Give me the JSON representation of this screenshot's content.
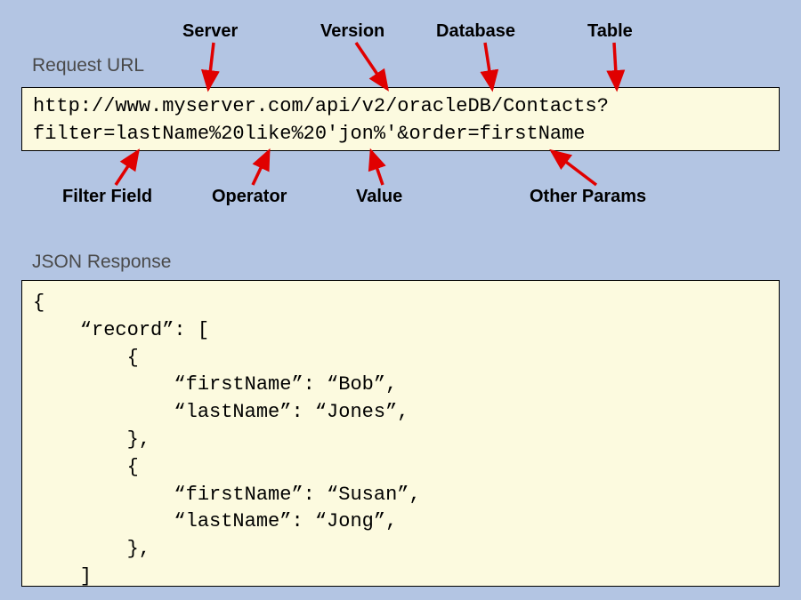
{
  "labels": {
    "request_url": "Request URL",
    "json_response": "JSON Response"
  },
  "annotations": {
    "server": "Server",
    "version": "Version",
    "database": "Database",
    "table": "Table",
    "filter_field": "Filter Field",
    "operator": "Operator",
    "value": "Value",
    "other_params": "Other Params"
  },
  "url_box": {
    "line1": "http://www.myserver.com/api/v2/oracleDB/Contacts?",
    "line2": "filter=lastName%20like%20'jon%'&order=firstName"
  },
  "json_box": "{\n    “record”: [\n        {\n            “firstName”: “Bob”,\n            “lastName”: “Jones”,\n        },\n        {\n            “firstName”: “Susan”,\n            “lastName”: “Jong”,\n        },\n    ]\n}"
}
